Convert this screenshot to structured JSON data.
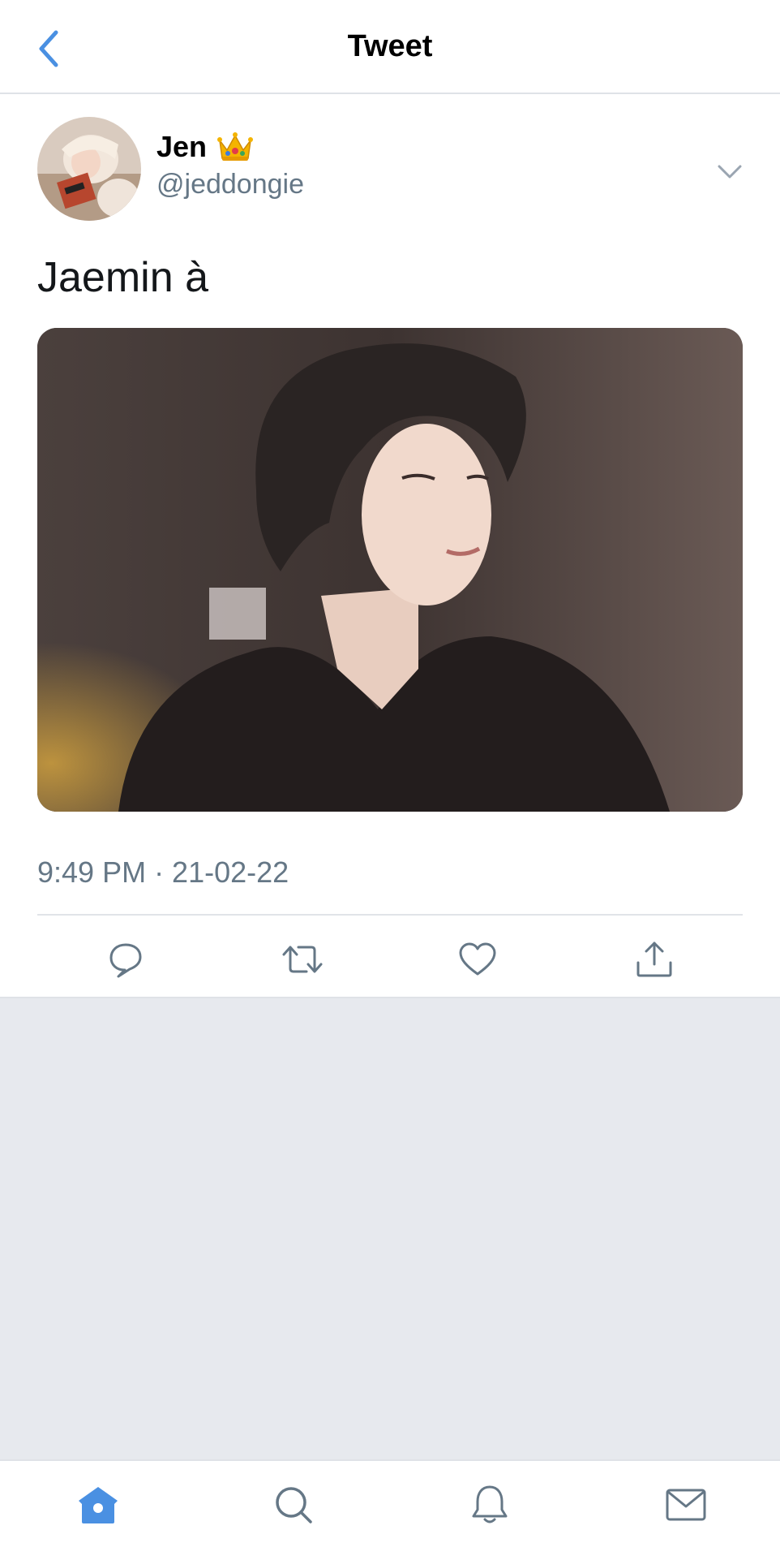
{
  "header": {
    "title": "Tweet",
    "back_icon": "chevron-left-icon",
    "accent_color": "#4a90e2"
  },
  "tweet": {
    "author_name": "Jen",
    "author_badge": "crown-emoji",
    "author_handle": "@jeddongie",
    "text": "Jaemin à",
    "timestamp": "9:49 PM · 21-02-22",
    "media_alt": "photo",
    "actions": [
      "reply-icon",
      "retweet-icon",
      "like-icon",
      "share-icon"
    ]
  },
  "tabbar": {
    "items": [
      "home-icon",
      "search-icon",
      "notifications-icon",
      "messages-icon"
    ],
    "active": "home-icon"
  }
}
